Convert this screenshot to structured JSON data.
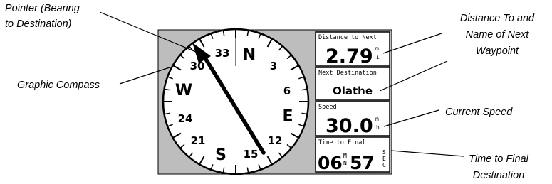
{
  "callouts": {
    "pointer": [
      "Pointer (Bearing",
      "to Destination)"
    ],
    "compass": "Graphic Compass",
    "distance": [
      "Distance To and",
      "Name of Next",
      "Waypoint"
    ],
    "speed": "Current Speed",
    "time_final": [
      "Time to Final",
      "Destination"
    ]
  },
  "compass": {
    "north": "N",
    "east": "E",
    "south": "S",
    "west": "W",
    "n3": "3",
    "n6": "6",
    "n12": "12",
    "n15": "15",
    "n21": "21",
    "n24": "24",
    "n30": "30",
    "n33": "33",
    "pointer_bearing_deg": 155
  },
  "panels": {
    "distance": {
      "title": "Distance to Next",
      "value": "2.79",
      "unit_top": "m",
      "unit_bottom": "i"
    },
    "destination": {
      "title": "Next Destination",
      "value": "Olathe"
    },
    "speed": {
      "title": "Speed",
      "value": "30.0",
      "unit_top": "m",
      "unit_bottom": "h"
    },
    "time": {
      "title": "Time to Final",
      "hours": "06",
      "hours_unit_top": "M",
      "hours_unit_bottom": "N",
      "minutes": "57",
      "minutes_unit_top": "S",
      "minutes_unit_bottom": "E",
      "minutes_unit_third": "C"
    }
  },
  "colors": {
    "device_gray": "#bdbdbd",
    "panel_bg": "#ffffff",
    "ink": "#000000"
  }
}
